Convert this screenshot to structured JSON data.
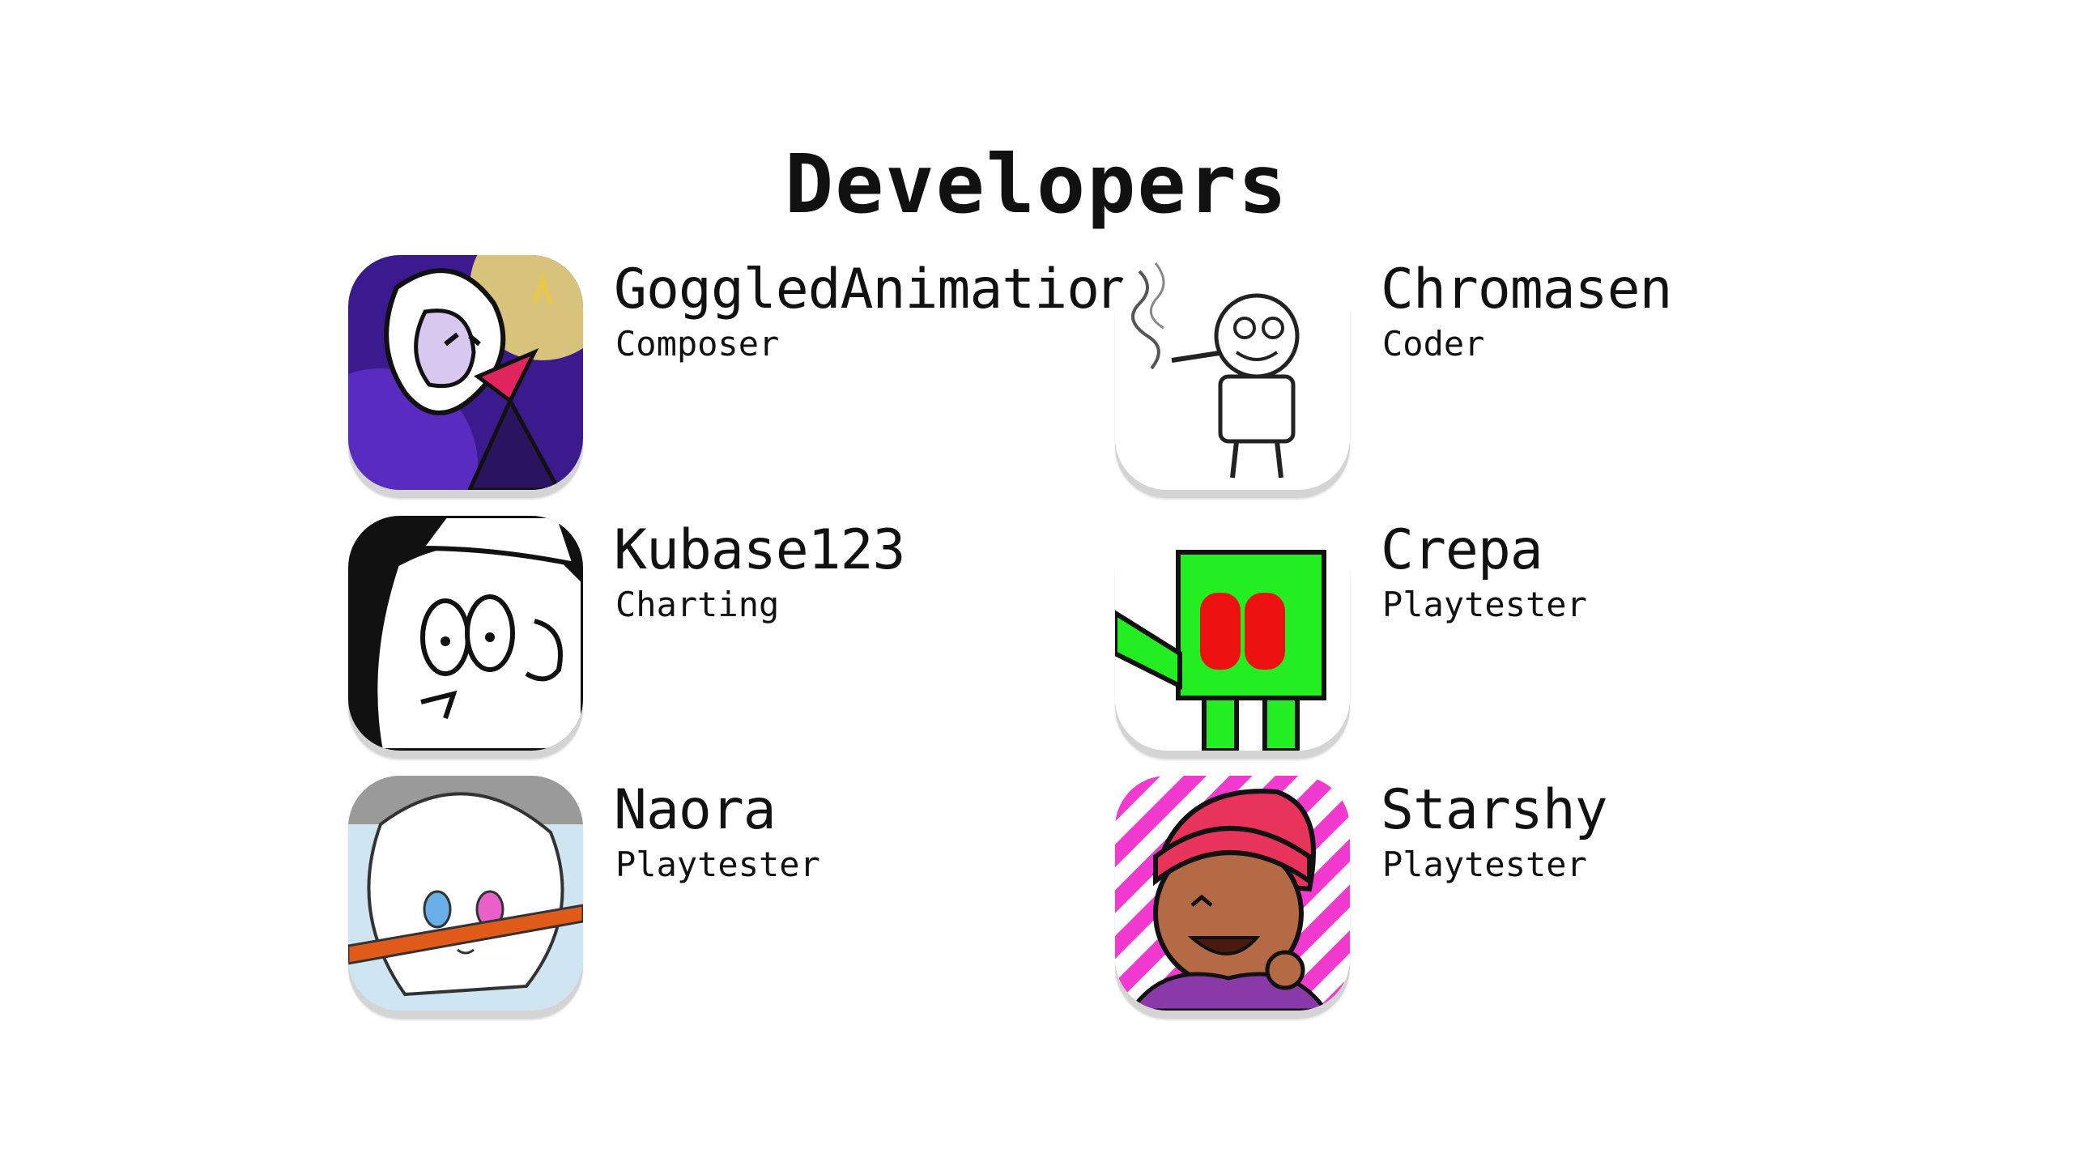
{
  "header": {
    "title": "Developers"
  },
  "developers": [
    {
      "name": "GoggledAnimations",
      "role": "Composer",
      "avatar": "goggled-avatar"
    },
    {
      "name": "Chromasen",
      "role": "Coder",
      "avatar": "chromasen-avatar"
    },
    {
      "name": "Kubase123",
      "role": "Charting",
      "avatar": "kubase-avatar"
    },
    {
      "name": "Crepa",
      "role": "Playtester",
      "avatar": "crepa-avatar"
    },
    {
      "name": "Naora",
      "role": "Playtester",
      "avatar": "naora-avatar"
    },
    {
      "name": "Starshy",
      "role": "Playtester",
      "avatar": "starshy-avatar"
    }
  ]
}
